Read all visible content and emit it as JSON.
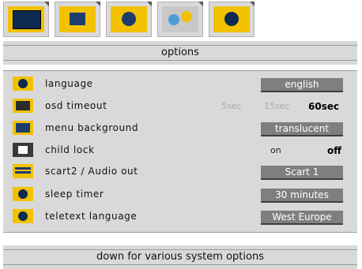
{
  "tabs": [
    {
      "icon": "monitor-icon"
    },
    {
      "icon": "picture-settings-icon"
    },
    {
      "icon": "speaker-icon"
    },
    {
      "icon": "features-icon"
    },
    {
      "icon": "globe-icon"
    }
  ],
  "header": {
    "title": "options"
  },
  "options": [
    {
      "label": "language",
      "value": "english",
      "icon": "globe-icon"
    },
    {
      "label": "osd timeout",
      "choices": [
        "5sec",
        "15sec",
        "60sec"
      ],
      "selected": "60sec",
      "icon": "timer-icon"
    },
    {
      "label": "menu background",
      "value": "translucent",
      "icon": "background-icon"
    },
    {
      "label": "child lock",
      "choices": [
        "on",
        "off"
      ],
      "selected": "off",
      "icon": "lock-icon"
    },
    {
      "label": "scart2 / Audio out",
      "value": "Scart 1",
      "icon": "scart-icon"
    },
    {
      "label": "sleep timer",
      "value": "30  minutes",
      "icon": "globe-icon"
    },
    {
      "label": "teletext language",
      "value": "West Europe",
      "icon": "globe-icon"
    }
  ],
  "footer": {
    "hint": "down for various system options"
  }
}
